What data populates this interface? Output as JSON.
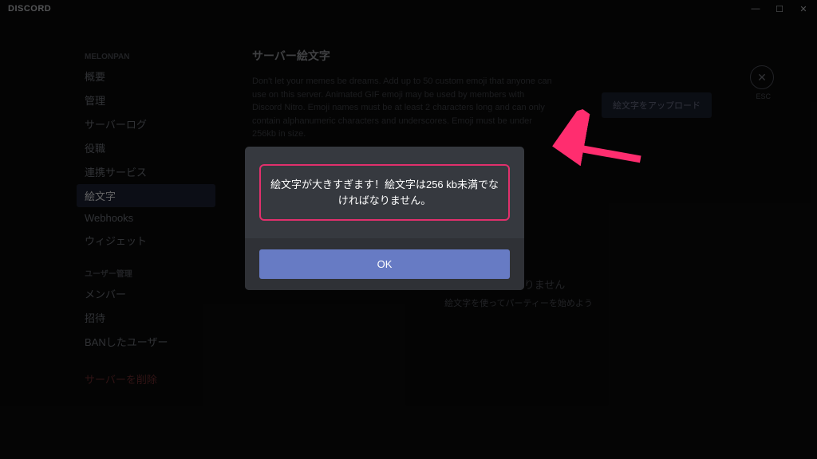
{
  "app": {
    "name": "DISCORD"
  },
  "windowControls": {
    "min": "—",
    "max": "☐",
    "close": "✕"
  },
  "sidebar": {
    "section1": "Melonpan",
    "items1": [
      "概要",
      "管理",
      "サーバーログ",
      "役職",
      "連携サービス",
      "絵文字",
      "Webhooks",
      "ウィジェット"
    ],
    "section2": "ユーザー管理",
    "items2": [
      "メンバー",
      "招待",
      "BANしたユーザー"
    ],
    "delete": "サーバーを削除"
  },
  "page": {
    "title": "サーバー絵文字",
    "description": "Don't let your memes be dreams. Add up to 50 custom emoji that anyone can use on this server. Animated GIF emoji may be used by members with Discord Nitro. Emoji names must be at least 2 characters long and can only contain alphanumeric characters and underscores. Emoji must be under 256kb in size.",
    "uploadBtn": "絵文字をアップロード",
    "closeLabel": "ESC",
    "emptyTitle": "絵文字はありません",
    "emptySub": "絵文字を使ってパーティーを始めよう"
  },
  "modal": {
    "message": "絵文字が大きすぎます！絵文字は256 kb未満でなければなりません。",
    "ok": "OK"
  }
}
